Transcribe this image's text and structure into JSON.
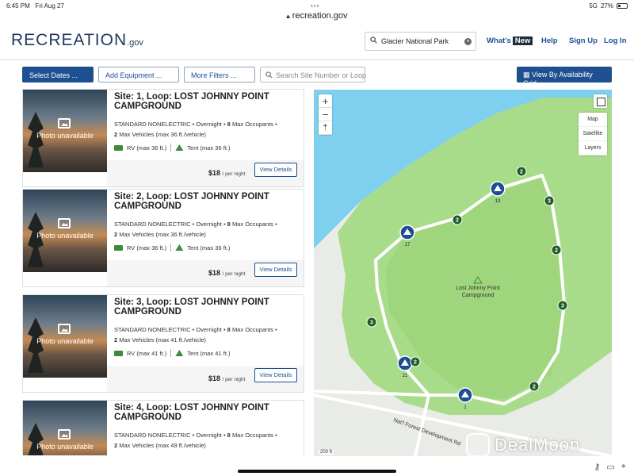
{
  "status": {
    "time": "6:45 PM",
    "date": "Fri Aug 27",
    "signal": "5G",
    "battery": "27%",
    "battery_level": 0.27
  },
  "browser": {
    "url": "recreation.gov"
  },
  "header": {
    "logo": "RECREATION",
    "logo_suffix": ".gov",
    "search_value": "Glacier National Park",
    "nav": {
      "whats": "What's",
      "new_badge": "New",
      "help": "Help",
      "signup": "Sign Up",
      "login": "Log In"
    }
  },
  "filters": {
    "select_dates": "Select Dates ...",
    "add_equipment": "Add Equipment ...",
    "more_filters": "More Filters ...",
    "search_placeholder": "Search Site Number or Loop",
    "view_grid": "View By Availability Grid"
  },
  "sites": [
    {
      "title": "Site: 1, Loop: LOST JOHNNY POINT CAMPGROUND",
      "type": "STANDARD NONELECTRIC",
      "stay": "Overnight",
      "occupants_num": "8",
      "occupants_label": "Max Occupants",
      "vehicles_num": "2",
      "vehicles_label": "Max Vehicles (max 36 ft./vehicle)",
      "rv": "RV (max 36 ft.)",
      "tent": "Tent (max 36 ft.)",
      "price": "$18",
      "per": "/ per night",
      "details": "View Details",
      "photo": "Photo unavailable"
    },
    {
      "title": "Site: 2, Loop: LOST JOHNNY POINT CAMPGROUND",
      "type": "STANDARD NONELECTRIC",
      "stay": "Overnight",
      "occupants_num": "8",
      "occupants_label": "Max Occupants",
      "vehicles_num": "2",
      "vehicles_label": "Max Vehicles (max 36 ft./vehicle)",
      "rv": "RV (max 36 ft.)",
      "tent": "Tent (max 36 ft.)",
      "price": "$18",
      "per": "/ per night",
      "details": "View Details",
      "photo": "Photo unavailable"
    },
    {
      "title": "Site: 3, Loop: LOST JOHNNY POINT CAMPGROUND",
      "type": "STANDARD NONELECTRIC",
      "stay": "Overnight",
      "occupants_num": "8",
      "occupants_label": "Max Occupants",
      "vehicles_num": "2",
      "vehicles_label": "Max Vehicles (max 41 ft./vehicle)",
      "rv": "RV (max 41 ft.)",
      "tent": "Tent (max 41 ft.)",
      "price": "$18",
      "per": "/ per night",
      "details": "View Details",
      "photo": "Photo unavailable"
    },
    {
      "title": "Site: 4, Loop: LOST JOHNNY POINT CAMPGROUND",
      "type": "STANDARD NONELECTRIC",
      "stay": "Overnight",
      "occupants_num": "8",
      "occupants_label": "Max Occupants",
      "vehicles_num": "2",
      "vehicles_label": "Max Vehicles (max 49 ft./vehicle)",
      "rv": "",
      "tent": "",
      "price": "",
      "per": "",
      "details": "",
      "photo": "Photo unavailable"
    }
  ],
  "map": {
    "controls": {
      "zoom_in": "+",
      "zoom_out": "−",
      "reset": "⇡",
      "map": "Map",
      "satellite": "Satellite",
      "layers": "Layers"
    },
    "campground_label_1": "Lost Johnny Point",
    "campground_label_2": "Campground",
    "road_label": "Nat'l Forest Development Rd",
    "scale": "200 ft",
    "cluster_markers": [
      "13",
      "17",
      "21",
      "1"
    ],
    "count_markers": [
      "2",
      "3",
      "2",
      "3",
      "2",
      "3",
      "2",
      "2"
    ],
    "colors": {
      "water": "#7fcfef",
      "land": "#a9dc8a",
      "inner": "#9fd57d",
      "marker": "#1d4f91",
      "count": "#235c26"
    }
  },
  "watermark": {
    "text": "DealMoon"
  }
}
